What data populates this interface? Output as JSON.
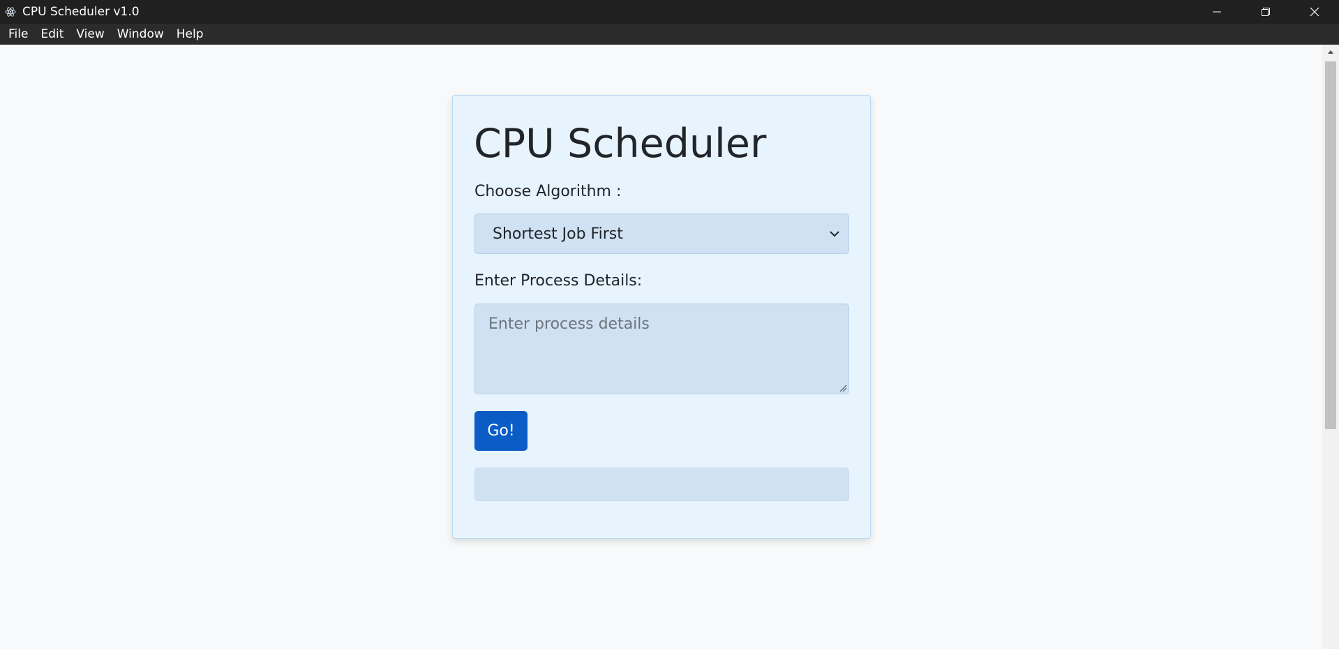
{
  "window": {
    "title": "CPU Scheduler v1.0",
    "icon": "electron-icon"
  },
  "menubar": {
    "items": [
      "File",
      "Edit",
      "View",
      "Window",
      "Help"
    ]
  },
  "form": {
    "heading": "CPU Scheduler",
    "algorithm_label": "Choose Algorithm :",
    "algorithm_selected": "Shortest Job First",
    "process_label": "Enter Process Details:",
    "process_placeholder": "Enter process details",
    "process_value": "",
    "go_label": "Go!",
    "output_text": ""
  },
  "colors": {
    "card_bg": "#e7f3fd",
    "input_bg": "#cfe1f3",
    "primary": "#0b5cc4",
    "titlebar": "#202020"
  }
}
